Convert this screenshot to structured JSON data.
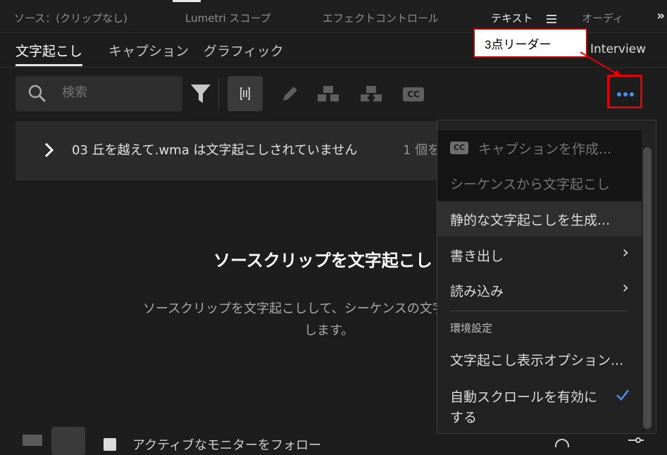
{
  "panel_tabs": [
    {
      "label": "ソース：(クリップなし)"
    },
    {
      "label": "Lumetri スコープ"
    },
    {
      "label": "エフェクトコントロール"
    },
    {
      "label": "テキスト"
    },
    {
      "label": "オーディ"
    }
  ],
  "panel_menu_icon": "hamburger-icon",
  "panel_overflow_glyph": "»",
  "sub_tabs": [
    {
      "label": "文字起こし"
    },
    {
      "label": "キャプション"
    },
    {
      "label": "グラフィック"
    }
  ],
  "interview_label": "Interview",
  "callout": {
    "text": "3点リーダー"
  },
  "toolbar": {
    "search_placeholder": "検索",
    "icons": [
      "search-icon",
      "filter-icon",
      "merge-icon",
      "pencil-icon",
      "split-speaker-icon",
      "merge-speaker-icon",
      "cc-icon",
      "more-icon"
    ],
    "cc_label": "CC"
  },
  "info": {
    "message": "03 丘を越えて.wma は文字起こしされていません",
    "count_text": "1 個を"
  },
  "empty_state": {
    "heading": "ソースクリップを文字起こし",
    "body_line1": "ソースクリップを文字起こしして、シーケンスの文字",
    "body_line2": "します。"
  },
  "bottom_bar": {
    "follow_label": "アクティブなモニターをフォロー"
  },
  "menu": {
    "items": [
      {
        "label": "キャプションを作成...",
        "disabled": true
      },
      {
        "label": "シーケンスから文字起こし",
        "disabled": true
      },
      {
        "label": "静的な文字起こしを生成...",
        "disabled": false
      },
      {
        "label": "書き出し",
        "disabled": false
      },
      {
        "label": "読み込み",
        "disabled": false
      },
      {
        "label": "環境設定",
        "disabled": false
      },
      {
        "label": "文字起こし表示オプション...",
        "disabled": false
      },
      {
        "label": "自動スクロールを有効に",
        "label_line2": "する",
        "disabled": false
      }
    ],
    "cc_badge": "CC",
    "submenu_arrow": "›",
    "accent_color": "#4a8fe8"
  },
  "colors": {
    "highlight_red": "#e50000",
    "accent_blue": "#4a8fe8",
    "background": "#1d1d1d"
  }
}
